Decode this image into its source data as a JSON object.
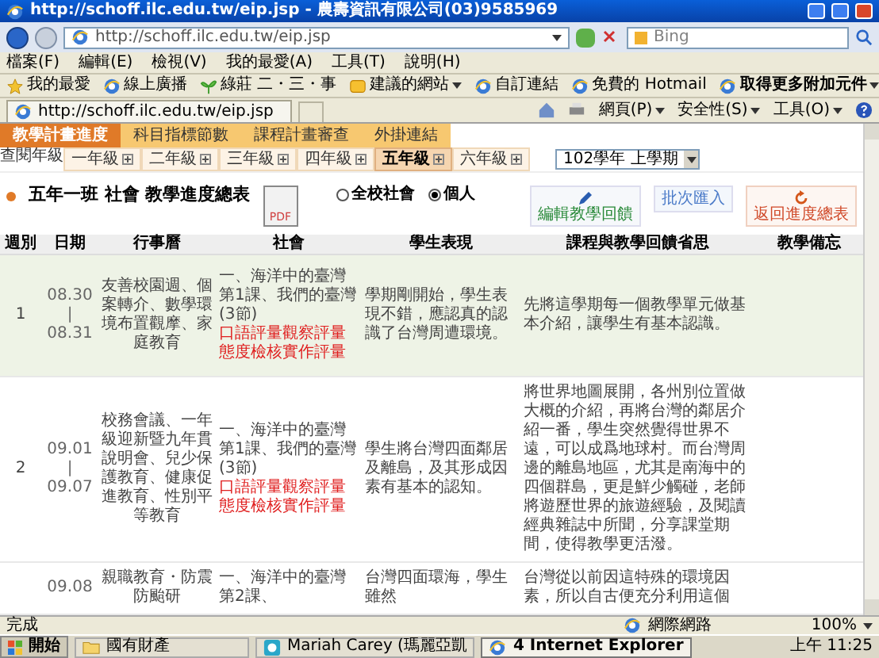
{
  "window": {
    "title": "http://schoff.ilc.edu.tw/eip.jsp - 農壽資訊有限公司(03)9585969"
  },
  "address_bar": {
    "url": "http://schoff.ilc.edu.tw/eip.jsp",
    "search_placeholder": "Bing"
  },
  "menu": [
    "檔案(F)",
    "編輯(E)",
    "檢視(V)",
    "我的最愛(A)",
    "工具(T)",
    "說明(H)"
  ],
  "favorites_bar": [
    {
      "label": "我的最愛",
      "kind": "star",
      "dropdown": false
    },
    {
      "label": "線上廣播",
      "kind": "page",
      "dropdown": false
    },
    {
      "label": "綠莊 二・三・事",
      "kind": "plant",
      "dropdown": false
    },
    {
      "label": "建議的網站",
      "kind": "suggest",
      "dropdown": true
    },
    {
      "label": "自訂連結",
      "kind": "page",
      "dropdown": false
    },
    {
      "label": "免費的 Hotmail",
      "kind": "page",
      "dropdown": false
    },
    {
      "label": "取得更多附加元件",
      "kind": "page",
      "dropdown": true
    }
  ],
  "tab": {
    "title": "http://schoff.ilc.edu.tw/eip.jsp"
  },
  "command_bar": [
    "網頁(P)",
    "安全性(S)",
    "工具(O)"
  ],
  "page": {
    "main_tabs": [
      {
        "label": "教學計畫進度",
        "selected": true
      },
      {
        "label": "科目指標節數",
        "selected": false
      },
      {
        "label": "課程計畫審查",
        "selected": false
      },
      {
        "label": "外掛連結",
        "selected": false
      }
    ],
    "grade_label": "查閱年級",
    "grade_tabs": [
      {
        "label": "一年級",
        "selected": false
      },
      {
        "label": "二年級",
        "selected": false
      },
      {
        "label": "三年級",
        "selected": false
      },
      {
        "label": "四年級",
        "selected": false
      },
      {
        "label": "五年級",
        "selected": true
      },
      {
        "label": "六年級",
        "selected": false
      }
    ],
    "term_select": "102學年 上學期",
    "heading": "五年一班 社會 教學進度總表",
    "pdf_label": "PDF",
    "scope_radios": [
      {
        "label": "全校社會",
        "selected": false
      },
      {
        "label": "個人",
        "selected": true
      }
    ],
    "actions": [
      {
        "label": "編輯教學回饋",
        "kind": "edit"
      },
      {
        "label": "批次匯入",
        "kind": "plain"
      },
      {
        "label": "返回進度總表",
        "kind": "back"
      }
    ],
    "table": {
      "columns": [
        "週別",
        "日期",
        "行事曆",
        "社會",
        "學生表現",
        "課程與教學回饋省思",
        "教學備忘"
      ],
      "rows": [
        {
          "highlighted": true,
          "week": "1",
          "date": [
            "08.30",
            "|",
            "08.31"
          ],
          "calendar": "友善校園週、個案轉介、數學環境布置觀摩、家庭教育",
          "social": [
            {
              "text": "一、海洋中的臺灣第1課、我們的臺灣(3節)",
              "kind": "plain"
            },
            {
              "text": "口語評量觀察評量態度檢核實作評量",
              "kind": "assessment"
            }
          ],
          "performance": "學期剛開始，學生表現不錯，應認真的認識了台灣周遭環境。",
          "reflection": "先將這學期每一個教學單元做基本介紹，讓學生有基本認識。"
        },
        {
          "highlighted": false,
          "week": "2",
          "date": [
            "09.01",
            "|",
            "09.07"
          ],
          "calendar": "校務會議、一年級迎新暨九年貫說明會、兒少保護教育、健康促進教育、性別平等教育",
          "social": [
            {
              "text": "一、海洋中的臺灣第1課、我們的臺灣(3節)",
              "kind": "plain"
            },
            {
              "text": "口語評量觀察評量態度檢核實作評量",
              "kind": "assessment"
            }
          ],
          "performance": "學生將台灣四面鄰居及離島，及其形成因素有基本的認知。",
          "reflection": "將世界地圖展開，各州別位置做大概的介紹，再將台灣的鄰居介紹一番，學生突然覺得世界不遠，可以成爲地球村。而台灣周邊的離島地區，尤其是南海中的四個群島，更是鮮少觸碰，老師將遊歷世界的旅遊經驗，及閱讀經典雜誌中所聞，分享課堂期間，使得教學更活潑。"
        },
        {
          "highlighted": false,
          "date": [
            "09.08"
          ],
          "calendar": "親職教育・防震防颱研",
          "social": [
            {
              "text": "一、海洋中的臺灣第2課、",
              "kind": "plain"
            }
          ],
          "performance": "台灣四面環海，學生雖然",
          "reflection": "台灣從以前因這特殊的環境因素，所以自古便充分利用這個"
        }
      ]
    }
  },
  "status_bar": {
    "text": "完成",
    "zone": "網際網路",
    "zoom": "100%"
  },
  "taskbar": {
    "start": "開始",
    "tasks": [
      {
        "label": "國有財產",
        "kind": "folder",
        "selected": false
      },
      {
        "label": "Mariah Carey (瑪麗亞凱",
        "kind": "app",
        "selected": false
      },
      {
        "label": "4 Internet Explorer",
        "kind": "ie",
        "selected": true
      }
    ],
    "clock": "上午 11:25"
  }
}
